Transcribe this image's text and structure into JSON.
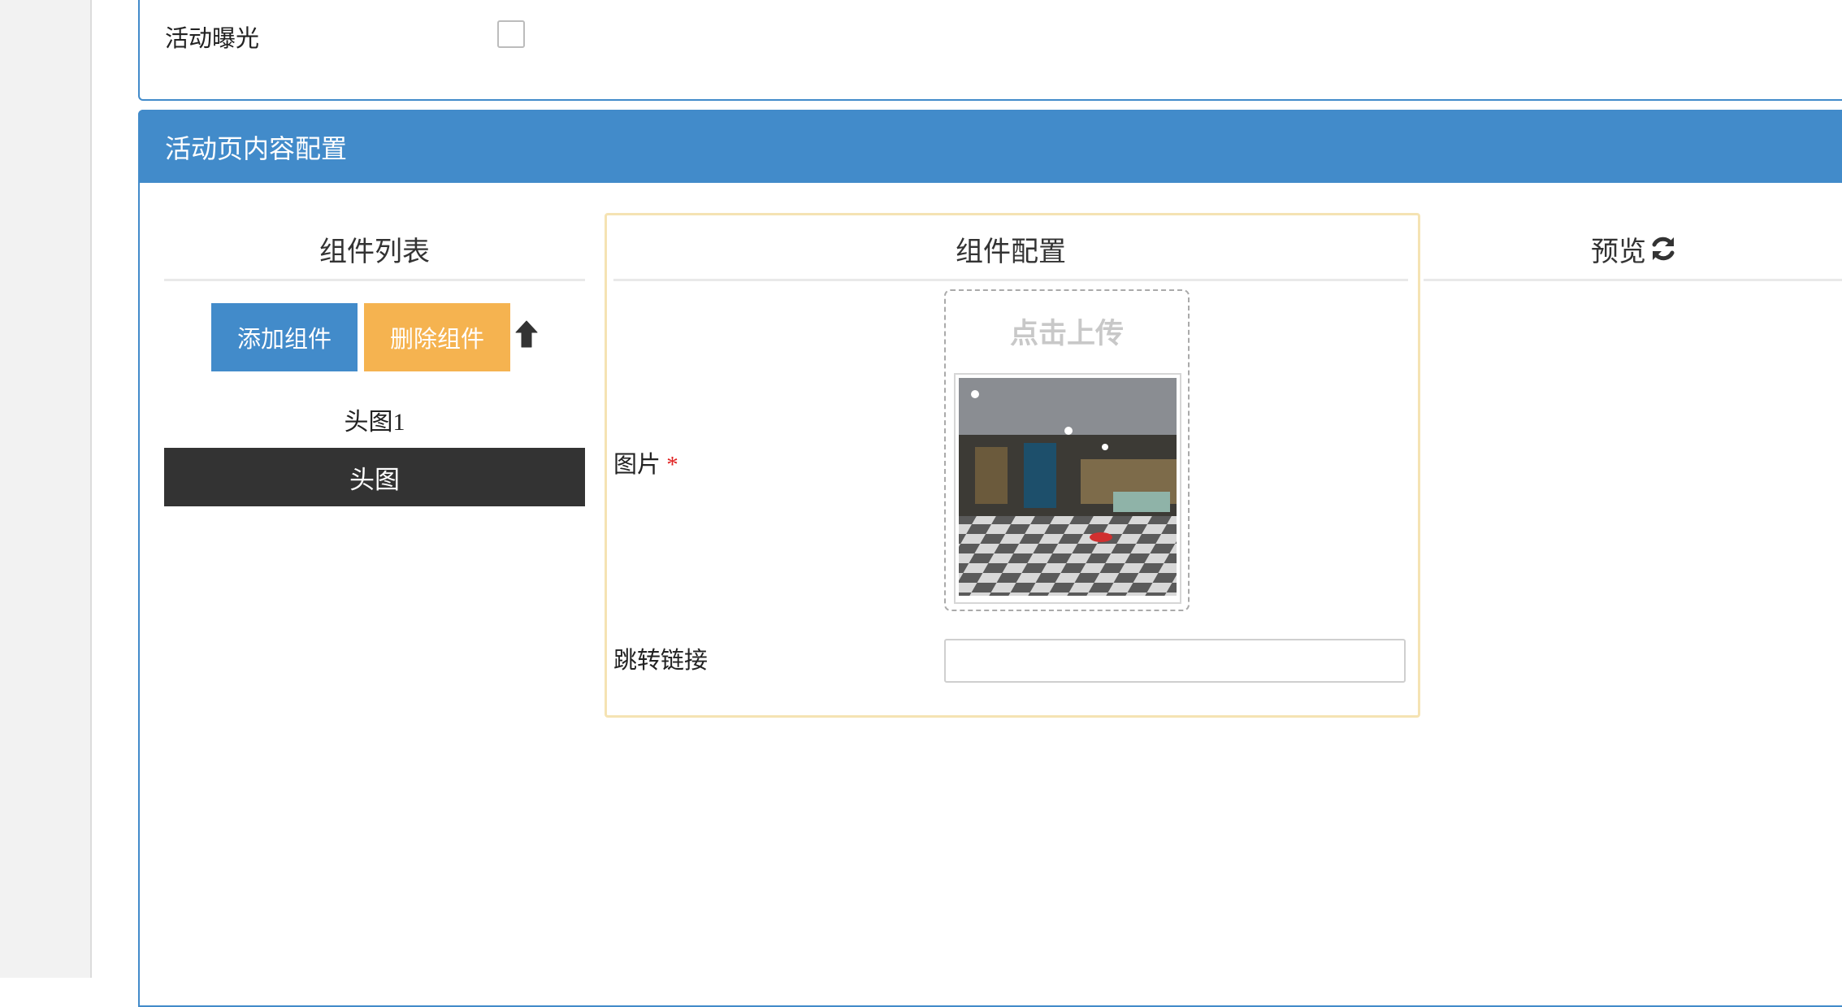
{
  "top_panel": {
    "exposure_label": "活动曝光",
    "exposure_checked": false
  },
  "content_panel": {
    "title": "活动页内容配置",
    "header_color": "#428bca"
  },
  "component_list": {
    "title": "组件列表",
    "add_button": "添加组件",
    "delete_button": "删除组件",
    "move_up_icon": "arrow-up-icon",
    "selected_component_name": "头图1",
    "items": [
      {
        "label": "头图"
      }
    ]
  },
  "component_config": {
    "title": "组件配置",
    "image_label": "图片",
    "required_mark": "*",
    "upload_text": "点击上传",
    "link_label": "跳转链接",
    "link_value": ""
  },
  "preview": {
    "title": "预览",
    "refresh_icon": "refresh-icon"
  },
  "colors": {
    "primary": "#428bca",
    "warning": "#f5b350",
    "dark_item": "#333333",
    "required": "#e02020"
  }
}
